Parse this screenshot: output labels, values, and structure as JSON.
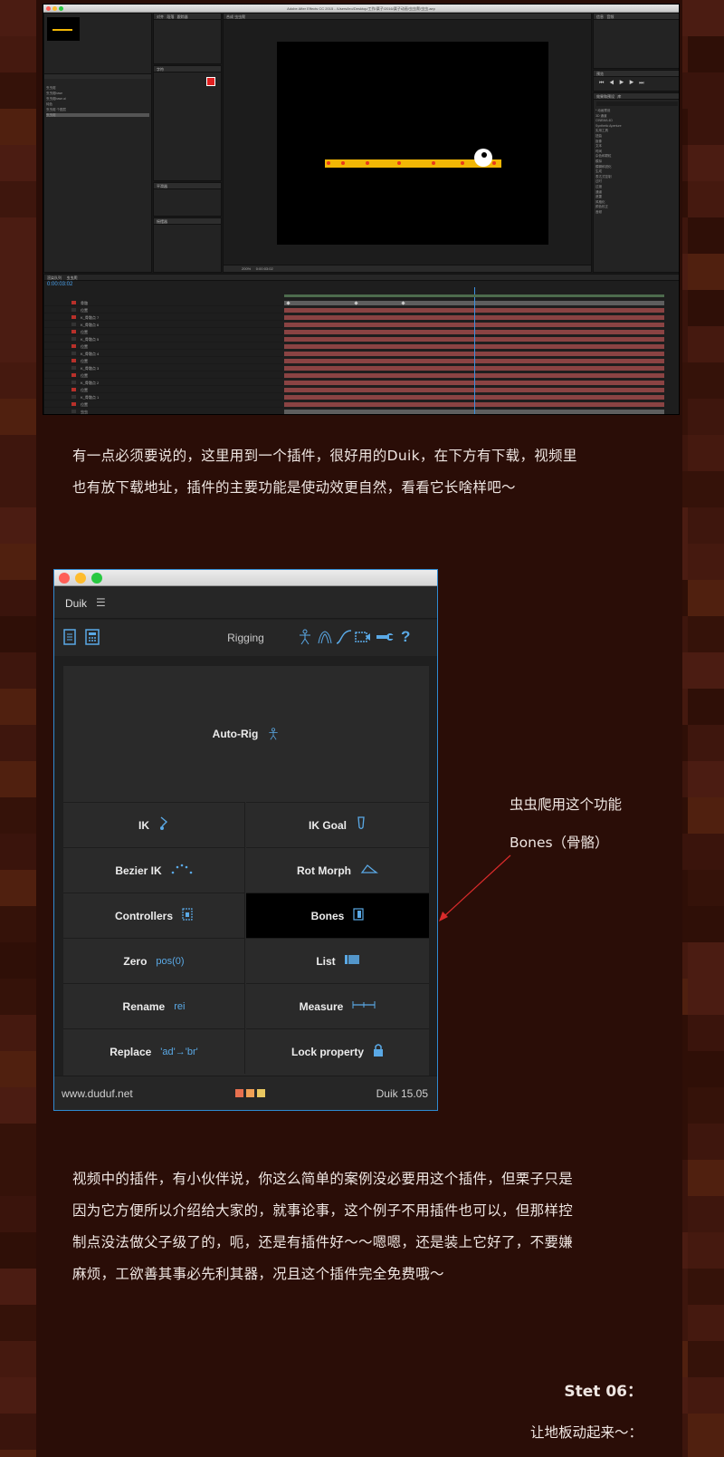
{
  "colors": {
    "page_bg": "#3a140c",
    "column_bg": "#2a0d07",
    "text": "#efe6e2",
    "duik_accent": "#5aa9e6",
    "duik_border": "#2f8bd1",
    "arrow": "#d92b2b",
    "beam": "#f2b705",
    "beam_dot": "#e83a1c"
  },
  "ae": {
    "window_title": "Adobe After Effects CC 2015 - /Users/leo/Desktop/工作/栗子/2016/栗子动画/虫虫爬/虫虫.aep",
    "comp_name": "虫虫爬",
    "viewer_zoom": "200%",
    "timecode": "0:00:03:02",
    "project_items": [
      "虫虫爬",
      "虫虫爬base",
      "虫虫爬base.ai",
      "纯色",
      "虫虫爬 个图层",
      "虫虫爬"
    ],
    "layer_rows": [
      "骨骼",
      "位置",
      "K_骨骼点 7",
      "K_骨骼点 6",
      "位置",
      "K_骨骼点 5",
      "位置",
      "K_骨骼点 4",
      "位置",
      "K_骨骼点 3",
      "位置",
      "K_骨骼点 2",
      "位置",
      "K_骨骼点 1",
      "位置",
      "虫虫"
    ],
    "effects_list": [
      "* 动画预设",
      "3D 通道",
      "CINEMA 4D",
      "Synthetic Aperture",
      "实用工具",
      "扭曲",
      "抠像",
      "文本",
      "时间",
      "杂色和颗粒",
      "模拟",
      "模糊和锐化",
      "生成",
      "表达式控制",
      "过时",
      "过渡",
      "通道",
      "遮罩",
      "风格化",
      "颜色校正",
      "音频"
    ]
  },
  "paragraphs": {
    "p1": [
      "有一点必须要说的，这里用到一个插件，很好用的Duik，在下方有下载，视频里",
      "也有放下载地址，插件的主要功能是使动效更自然，看看它长啥样吧～"
    ],
    "p2": [
      "视频中的插件，有小伙伴说，你这么简单的案例没必要用这个插件，但栗子只是",
      "因为它方便所以介绍给大家的，就事论事，这个例子不用插件也可以，但那样控",
      "制点没法做父子级了的，呃，还是有插件好～～嗯嗯，还是装上它好了，不要嫌",
      "麻烦，工欲善其事必先利其器，况且这个插件完全免费哦～"
    ]
  },
  "duik": {
    "title": "Duik",
    "menu_icon": "hamburger-icon",
    "section": "Rigging",
    "tool_icons": [
      "document-icon",
      "calculator-icon",
      "stick-figure-icon",
      "animation-icon",
      "curve-icon",
      "camera-icon",
      "wrench-icon",
      "help-icon"
    ],
    "autorig": "Auto-Rig",
    "buttons": [
      {
        "label": "IK",
        "icon": "ik-icon"
      },
      {
        "label": "IK Goal",
        "icon": "foot-icon"
      },
      {
        "label": "Bezier IK",
        "icon": "bezier-icon"
      },
      {
        "label": "Rot Morph",
        "icon": "morph-icon"
      },
      {
        "label": "Controllers",
        "icon": "controller-icon"
      },
      {
        "label": "Bones",
        "icon": "bone-icon"
      },
      {
        "label": "Zero",
        "icon_text": "pos(0)"
      },
      {
        "label": "List",
        "icon": "list-icon"
      },
      {
        "label": "Rename",
        "icon_text": "rei"
      },
      {
        "label": "Measure",
        "icon": "measure-icon"
      },
      {
        "label": "Replace",
        "icon_text": "'ad'→'br'"
      },
      {
        "label": "Lock property",
        "icon": "lock-icon"
      }
    ],
    "footer_url": "www.duduf.net",
    "footer_version": "Duik 15.05",
    "footer_colors": [
      "#e7704f",
      "#f0a055",
      "#e9c760"
    ]
  },
  "annotation": {
    "line1": "虫虫爬用这个功能",
    "line2": "Bones（骨骼）"
  },
  "step": {
    "title": "Stet 06：",
    "subtitle": "让地板动起来～："
  }
}
